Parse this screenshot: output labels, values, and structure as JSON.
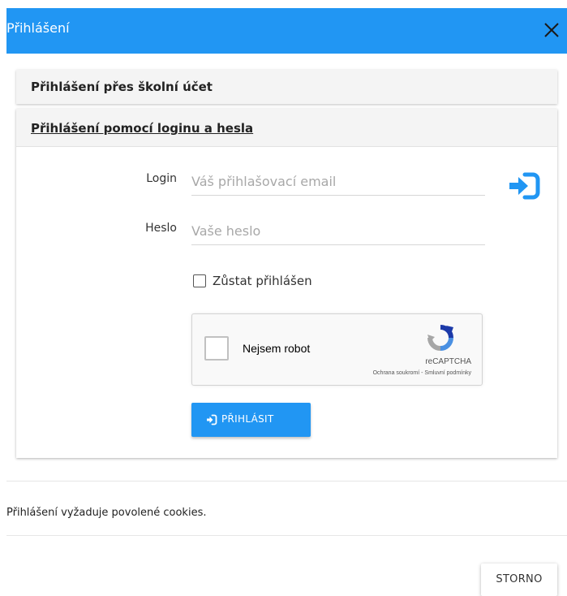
{
  "dialog": {
    "title": "Přihlášení",
    "close_icon": "close-icon",
    "header_color": "#2196f3"
  },
  "school_panel": {
    "title": "Přihlášení přes školní účet"
  },
  "login_panel": {
    "title": "Přihlášení pomocí loginu a hesla",
    "login_label": "Login",
    "login_placeholder": "Váš přihlašovací email",
    "login_value": "",
    "password_label": "Heslo",
    "password_placeholder": "Vaše heslo",
    "password_value": "",
    "login_icon": "sign-in-icon",
    "remember_label": "Zůstat přihlášen",
    "remember_checked": false,
    "captcha": {
      "label": "Nejsem robot",
      "brand": "reCAPTCHA",
      "terms": "Ochrana soukromí - Smluvní podmínky"
    },
    "submit_label": "PŘIHLÁSIT",
    "submit_icon": "sign-in-icon"
  },
  "footer": {
    "cookies_note": "Přihlášení vyžaduje povolené cookies.",
    "cancel_label": "STORNO"
  }
}
